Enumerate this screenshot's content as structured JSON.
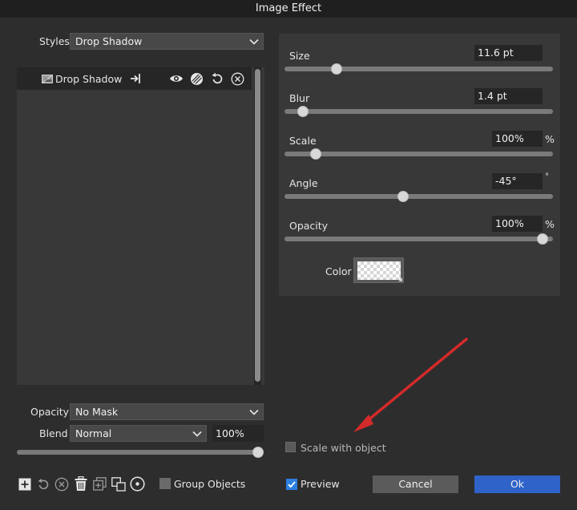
{
  "window": {
    "title": "Image Effect"
  },
  "styles": {
    "label": "Styles",
    "selected": "Drop Shadow"
  },
  "layer": {
    "name": "Drop Shadow"
  },
  "properties": {
    "size": {
      "label": "Size",
      "value": "11.6 pt",
      "unit": "",
      "position": 0.18
    },
    "blur": {
      "label": "Blur",
      "value": "1.4 pt",
      "unit": "",
      "position": 0.05
    },
    "scale": {
      "label": "Scale",
      "value": "100%",
      "unit": "%",
      "position": 0.1
    },
    "angle": {
      "label": "Angle",
      "value": "-45°",
      "unit": "°",
      "position": 0.44
    },
    "opacity": {
      "label": "Opacity",
      "value": "100%",
      "unit": "%",
      "position": 0.98
    },
    "color": {
      "label": "Color"
    }
  },
  "bottom_left": {
    "opacity_label": "Opacity",
    "opacity_selected": "No Mask",
    "blend_label": "Blend",
    "blend_selected": "Normal",
    "blend_value": "100%",
    "blend_slider_position": 1.0
  },
  "scale_with_object": {
    "label": "Scale with object",
    "checked": false
  },
  "group_objects": {
    "label": "Group Objects",
    "checked": false
  },
  "preview": {
    "label": "Preview",
    "checked": true
  },
  "buttons": {
    "cancel": "Cancel",
    "ok": "Ok"
  },
  "colors": {
    "accent": "#2f63c9",
    "annotation_arrow": "#d42a2a"
  }
}
